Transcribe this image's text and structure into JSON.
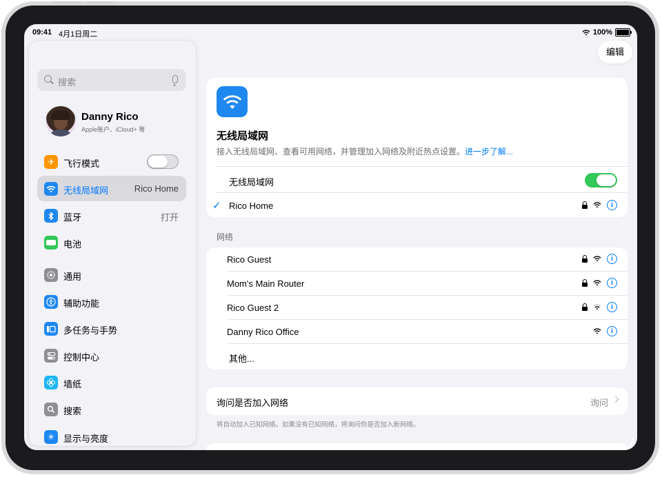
{
  "status_bar": {
    "time": "09:41",
    "date": "4月1日周二",
    "battery": "100%"
  },
  "sidebar": {
    "search_placeholder": "搜索",
    "profile": {
      "name": "Danny Rico",
      "subtitle": "Apple账户、iCloud+ 等"
    },
    "items": [
      {
        "label": "飞行模式",
        "value": "",
        "icon": "airplane-icon",
        "color": "#ff9500"
      },
      {
        "label": "无线局域网",
        "value": "Rico Home",
        "icon": "wifi-icon",
        "color": "#1e88f0"
      },
      {
        "label": "蓝牙",
        "value": "打开",
        "icon": "bluetooth-icon",
        "color": "#1e88f0"
      },
      {
        "label": "电池",
        "value": "",
        "icon": "battery-icon",
        "color": "#34c759"
      },
      {
        "label": "通用",
        "value": "",
        "icon": "gear-icon",
        "color": "#8e8e93"
      },
      {
        "label": "辅助功能",
        "value": "",
        "icon": "accessibility-icon",
        "color": "#1e88f0"
      },
      {
        "label": "多任务与手势",
        "value": "",
        "icon": "multitasking-icon",
        "color": "#1e88f0"
      },
      {
        "label": "控制中心",
        "value": "",
        "icon": "control-center-icon",
        "color": "#8e8e93"
      },
      {
        "label": "墙纸",
        "value": "",
        "icon": "wallpaper-icon",
        "color": "#1eb6f0"
      },
      {
        "label": "搜索",
        "value": "",
        "icon": "search-icon",
        "color": "#8e8e93"
      },
      {
        "label": "显示与亮度",
        "value": "",
        "icon": "brightness-icon",
        "color": "#1e88f0"
      }
    ]
  },
  "toolbar": {
    "edit_label": "编辑"
  },
  "wifi_header": {
    "title": "无线局域网",
    "description": "接入无线局域网、查看可用网络，并管理加入网络及附近热点设置。",
    "learn_more": "进一步了解...",
    "toggle_label": "无线局域网",
    "toggle_on": true,
    "connected_network": "Rico Home"
  },
  "networks_section": {
    "title": "网络",
    "networks": [
      {
        "name": "Rico Guest",
        "secured": true
      },
      {
        "name": "Mom's Main Router",
        "secured": true
      },
      {
        "name": "Rico Guest 2",
        "secured": true
      },
      {
        "name": "Danny Rico Office",
        "secured": false
      }
    ],
    "other_label": "其他..."
  },
  "ask_to_join": {
    "label": "询问是否加入网络",
    "value": "询问",
    "note": "将自动加入已知网络。如果没有已知网络，将询问你是否加入新网络。"
  },
  "colors": {
    "accent": "#007aff",
    "toggle_on": "#34c759",
    "background": "#f2f2f7"
  }
}
